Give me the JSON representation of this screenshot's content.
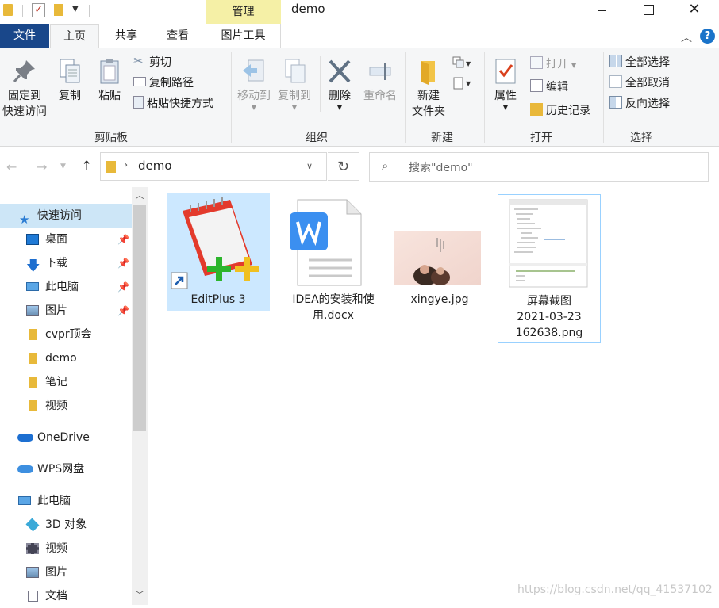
{
  "window": {
    "title": "demo",
    "manage_label": "管理",
    "close_glyph": "✕"
  },
  "tabs": {
    "file": "文件",
    "home": "主页",
    "share": "共享",
    "view": "查看",
    "picture_tools": "图片工具"
  },
  "ribbon": {
    "clipboard": {
      "label": "剪贴板",
      "pin_quick_access": [
        "固定到",
        "快速访问"
      ],
      "copy": "复制",
      "paste": "粘贴",
      "cut": "剪切",
      "copy_path": "复制路径",
      "paste_shortcut": "粘贴快捷方式"
    },
    "organize": {
      "label": "组织",
      "move_to": "移动到",
      "copy_to": "复制到",
      "delete": "删除",
      "rename": "重命名"
    },
    "new": {
      "label": "新建",
      "new_folder": [
        "新建",
        "文件夹"
      ]
    },
    "open": {
      "label": "打开",
      "properties": "属性",
      "open": "打开",
      "edit": "编辑",
      "history": "历史记录"
    },
    "select": {
      "label": "选择",
      "select_all": "全部选择",
      "select_none": "全部取消",
      "invert": "反向选择"
    }
  },
  "address": {
    "path": "demo",
    "search_placeholder": "搜索\"demo\""
  },
  "nav": {
    "quick_access": "快速访问",
    "items": [
      {
        "label": "桌面",
        "icon": "desktop-icon",
        "pinned": true
      },
      {
        "label": "下载",
        "icon": "download-icon",
        "pinned": true
      },
      {
        "label": "此电脑",
        "icon": "computer-icon",
        "pinned": true
      },
      {
        "label": "图片",
        "icon": "pictures-icon",
        "pinned": true
      },
      {
        "label": "cvpr顶会",
        "icon": "folder-icon",
        "pinned": false
      },
      {
        "label": "demo",
        "icon": "folder-icon",
        "pinned": false
      },
      {
        "label": "笔记",
        "icon": "folder-icon",
        "pinned": false
      },
      {
        "label": "视频",
        "icon": "folder-icon",
        "pinned": false
      }
    ],
    "onedrive": "OneDrive",
    "wps": "WPS网盘",
    "this_pc": "此电脑",
    "pc_items": [
      {
        "label": "3D 对象",
        "icon": "3d-objects-icon"
      },
      {
        "label": "视频",
        "icon": "videos-icon"
      },
      {
        "label": "图片",
        "icon": "pictures-icon"
      },
      {
        "label": "文档",
        "icon": "documents-icon"
      }
    ]
  },
  "files": [
    {
      "name": "EditPlus 3",
      "icon": "editplus-shortcut-icon",
      "selected": true
    },
    {
      "name": "IDEA的安装和使用.docx",
      "line1": "IDEA的安装和使",
      "line2": "用.docx",
      "icon": "wps-docx-icon"
    },
    {
      "name": "xingye.jpg",
      "icon": "image-thumbnail"
    },
    {
      "name": "屏幕截图 2021-03-23 162638.png",
      "line1": "屏幕截图",
      "line2": "2021-03-23",
      "line3": "162638.png",
      "icon": "screenshot-thumbnail",
      "focused": true
    }
  ],
  "watermark": "https://blog.csdn.net/qq_41537102",
  "colors": {
    "file_tab": "#19478a",
    "manage_tab": "#f5f0a6",
    "selection": "#cce8ff",
    "quick_access_highlight": "#cde6f7"
  }
}
